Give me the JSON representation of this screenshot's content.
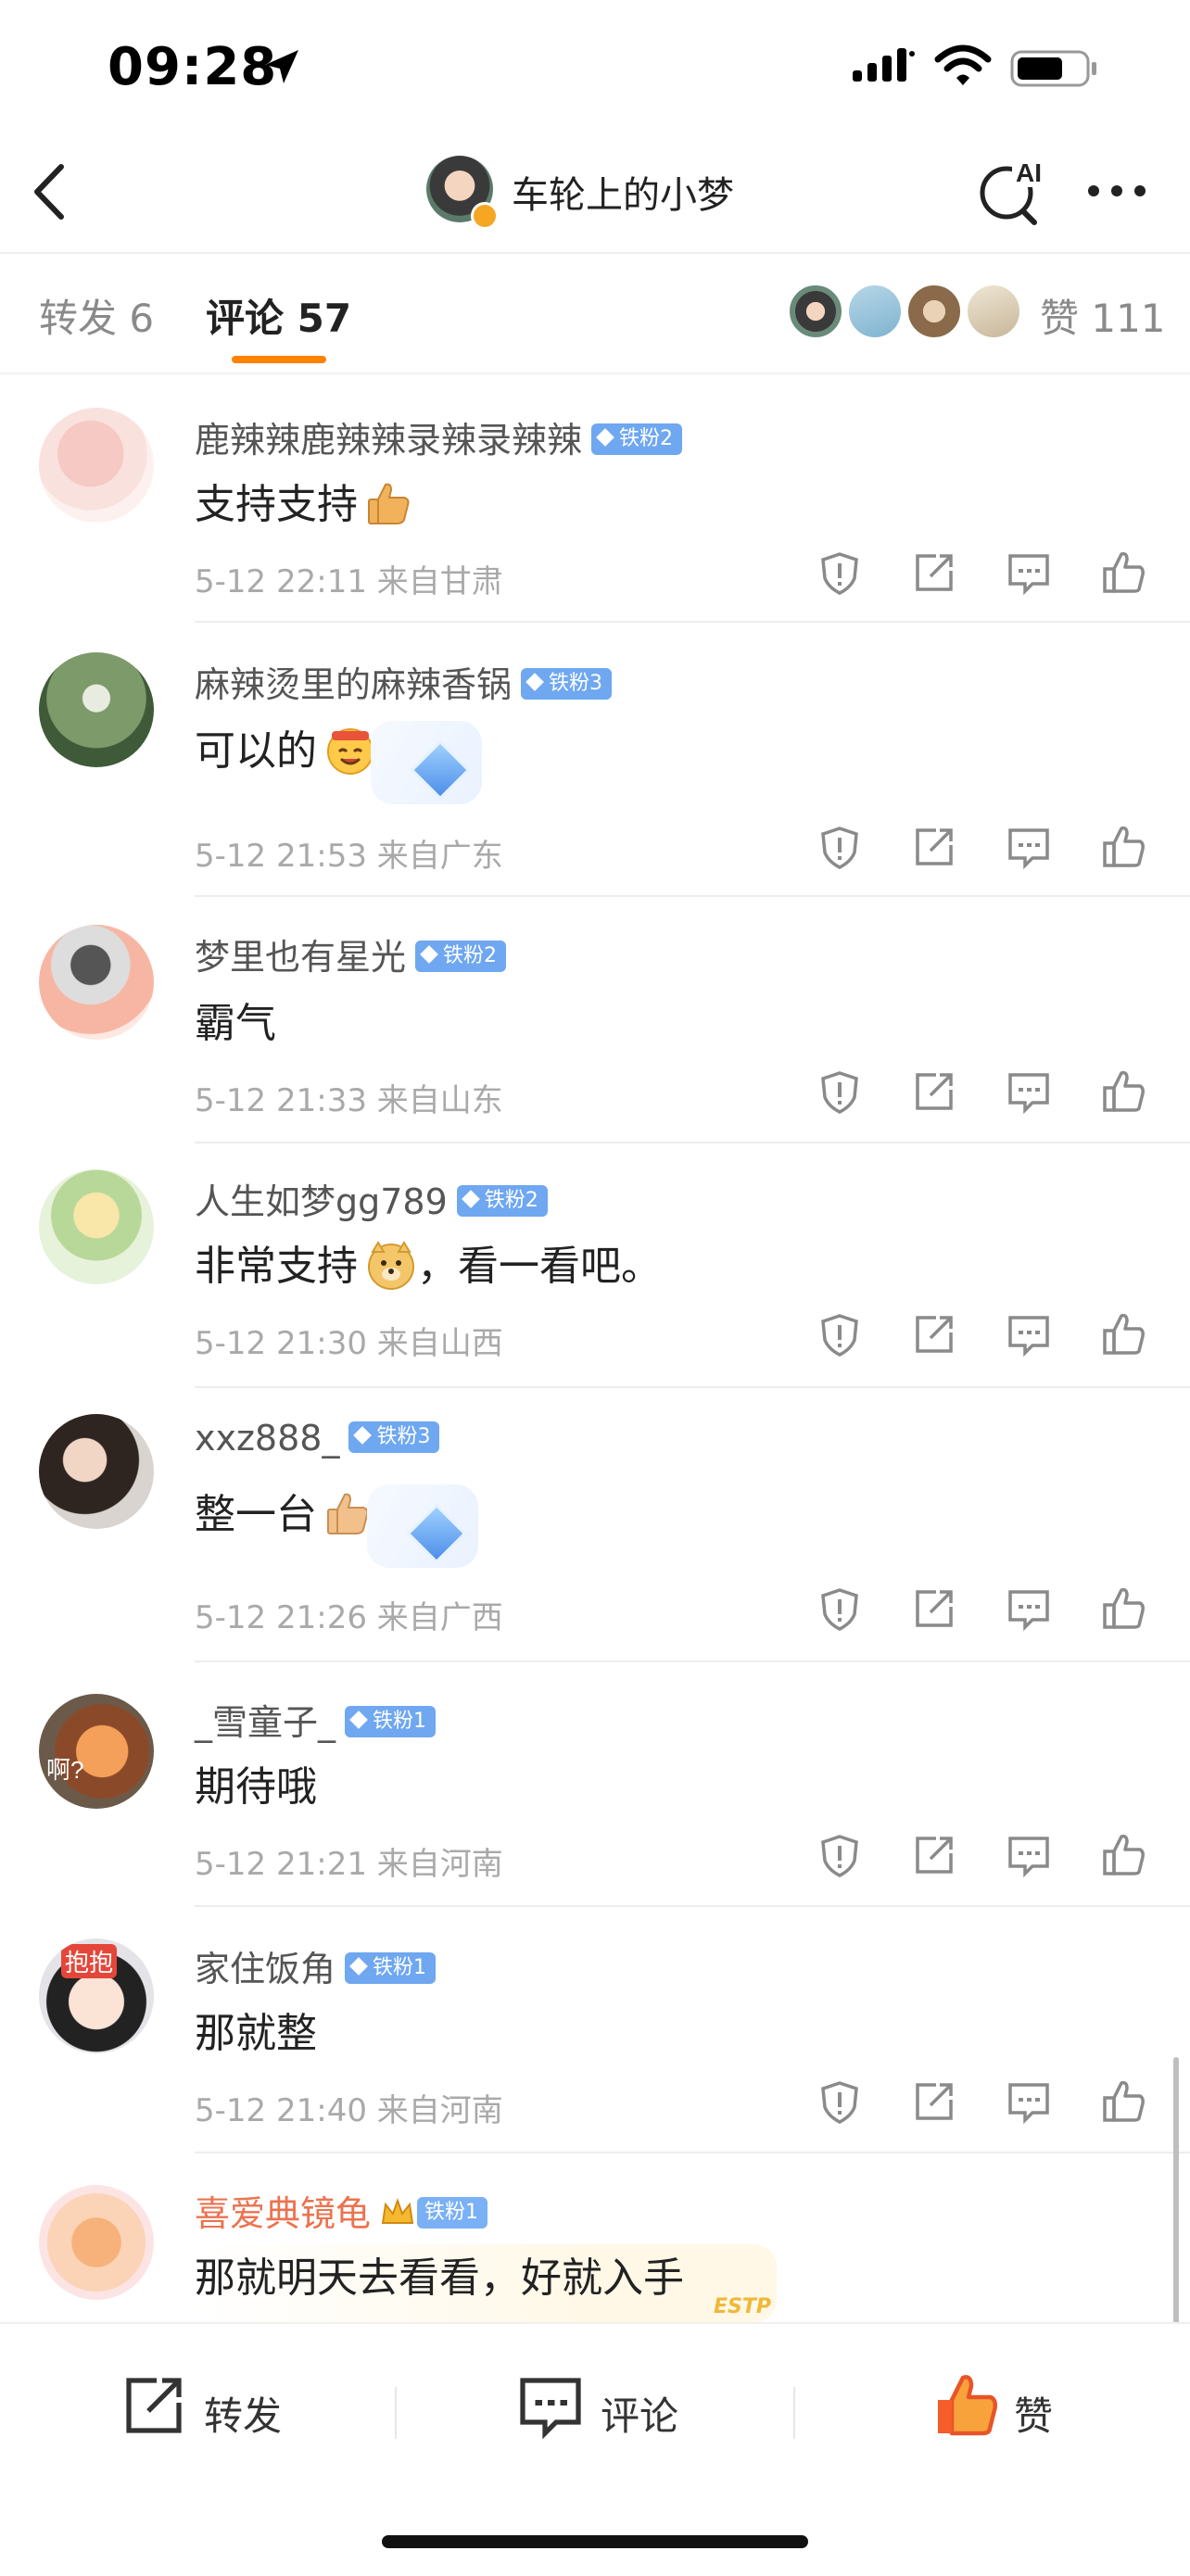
{
  "status_bar": {
    "time": "09:28"
  },
  "nav": {
    "title": "车轮上的小梦",
    "ai_label": "AI"
  },
  "tabs": {
    "repost": "转发 6",
    "comment": "评论 57",
    "like": "赞 111"
  },
  "comments": [
    {
      "name": "鹿辣辣鹿辣辣录辣录辣辣",
      "badge": "铁粉2",
      "text": "支持支持",
      "emoji": "thumbs-up-icon",
      "meta": "5-12 22:11 来自甘肃"
    },
    {
      "name": "麻辣烫里的麻辣香锅",
      "badge": "铁粉3",
      "text": "可以的",
      "emoji": "happy-face-icon",
      "meta": "5-12 21:53 来自广东"
    },
    {
      "name": "梦里也有星光",
      "badge": "铁粉2",
      "text": "霸气",
      "meta": "5-12 21:33 来自山东"
    },
    {
      "name": "人生如梦gg789",
      "badge": "铁粉2",
      "text": "非常支持",
      "text_after": "，看一看吧。",
      "emoji": "doge-icon",
      "meta": "5-12 21:30 来自山西"
    },
    {
      "name": "xxz888_",
      "badge": "铁粉3",
      "text": "整一台",
      "emoji": "thumbs-up-icon",
      "meta": "5-12 21:26 来自广西"
    },
    {
      "name": "_雪童子_",
      "badge": "铁粉1",
      "text": "期待哦",
      "meta": "5-12 21:21 来自河南"
    },
    {
      "name": "家住饭角",
      "badge": "铁粉1",
      "text": "那就整",
      "meta": "5-12 21:40 来自河南"
    },
    {
      "name": "喜爱典镜龟",
      "badge": "铁粉1",
      "text": "那就明天去看看，好就入手",
      "tag": "ESTP"
    }
  ],
  "avatar_texts": {
    "c6": "啊?",
    "c7": "抱抱"
  },
  "bottom_bar": {
    "repost": "转发",
    "comment": "评论",
    "like": "赞"
  },
  "colors": {
    "accent": "#ff8200",
    "badge_blue": "#6fa7f0",
    "like_red": "#f55d2a"
  }
}
